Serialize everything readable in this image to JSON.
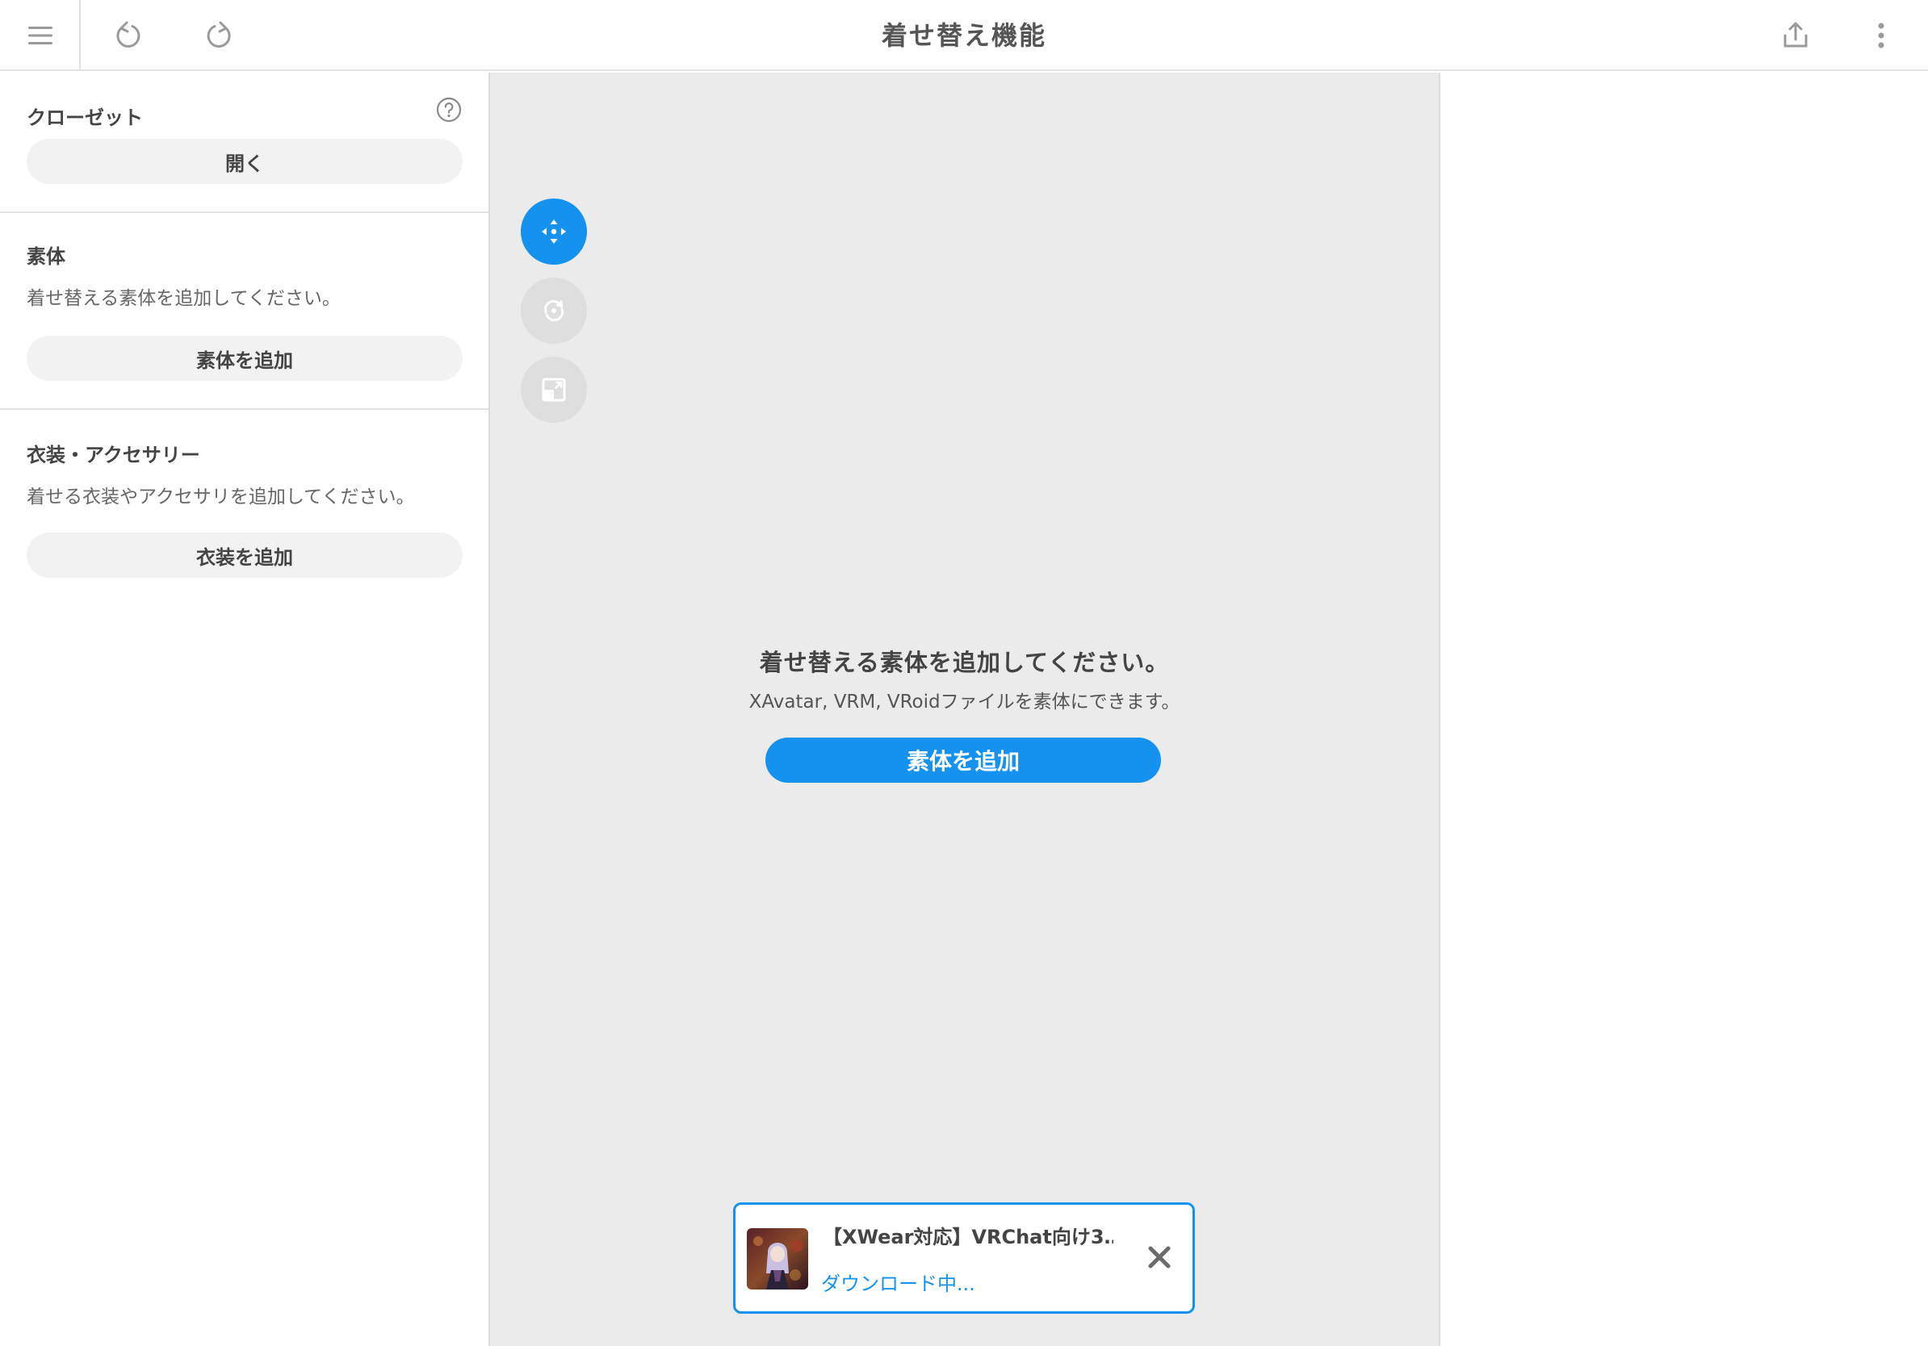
{
  "header": {
    "title": "着せ替え機能",
    "icons": [
      "menu-icon",
      "undo-icon",
      "redo-icon",
      "share-icon",
      "more-vertical-icon"
    ]
  },
  "closet": {
    "title": "クローゼット",
    "open_label": "開く"
  },
  "body_section": {
    "title": "素体",
    "description": "着せ替える素体を追加してください。",
    "add_label": "素体を追加"
  },
  "outfit_section": {
    "title": "衣装・アクセサリー",
    "description": "着せる衣装やアクセサリを追加してください。",
    "add_label": "衣装を追加"
  },
  "viewport": {
    "tools": [
      "move-icon",
      "rotate-icon",
      "scale-icon"
    ],
    "empty_title": "着せ替える素体を追加してください。",
    "empty_subtitle": "XAvatar, VRM, VRoidファイルを素体にできます。",
    "add_label": "素体を追加"
  },
  "toast": {
    "title": "【XWear対応】VRChat向け3…",
    "status": "ダウンロード中..."
  },
  "colors": {
    "accent": "#1592f0",
    "viewport_bg": "#ebebeb",
    "pill_bg": "#f2f2f2"
  }
}
